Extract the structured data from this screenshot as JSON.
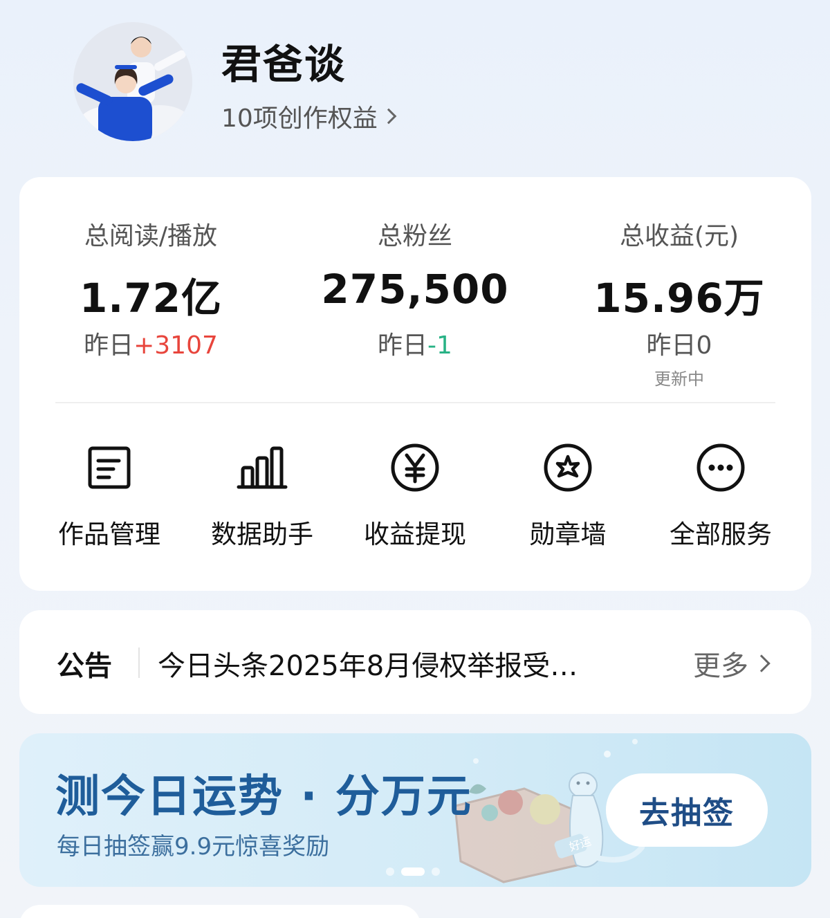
{
  "profile": {
    "name": "君爸谈",
    "benefits_link": "10项创作权益"
  },
  "stats": [
    {
      "label": "总阅读/播放",
      "value": "1.72亿",
      "change_prefix": "昨日",
      "change_value": "+3107",
      "trend": "up"
    },
    {
      "label": "总粉丝",
      "value": "275,500",
      "change_prefix": "昨日",
      "change_value": "-1",
      "trend": "down"
    },
    {
      "label": "总收益(元)",
      "value": "15.96万",
      "change_prefix": "昨日",
      "change_value": "0",
      "trend": "none",
      "note": "更新中"
    }
  ],
  "tools": [
    {
      "label": "作品管理",
      "icon": "document-icon"
    },
    {
      "label": "数据助手",
      "icon": "bar-chart-icon"
    },
    {
      "label": "收益提现",
      "icon": "yuan-coin-icon"
    },
    {
      "label": "勋章墙",
      "icon": "star-badge-icon"
    },
    {
      "label": "全部服务",
      "icon": "more-dots-icon"
    }
  ],
  "notice": {
    "title": "公告",
    "text": "今日头条2025年8月侵权举报受…",
    "more": "更多"
  },
  "banner": {
    "title": "测今日运势 · 分万元",
    "subtitle": "每日抽签赢9.9元惊喜奖励",
    "button": "去抽签",
    "art_tag": "好运",
    "carousel_slides": 3,
    "carousel_active": 2
  },
  "colors": {
    "positive": "#e8453c",
    "negative": "#28b285",
    "banner_title": "#1f5d9a",
    "banner_button_text": "#1f4d86"
  }
}
